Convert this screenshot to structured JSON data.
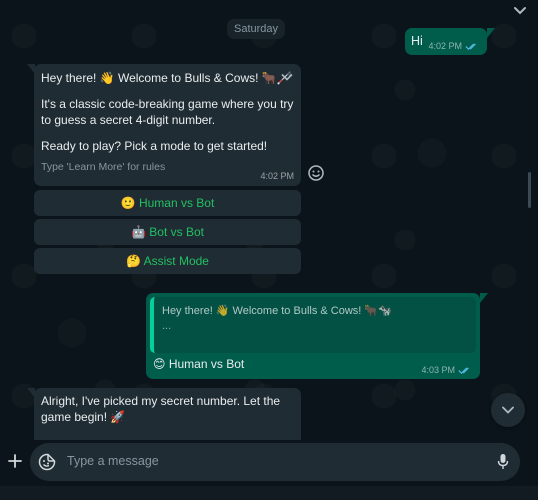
{
  "date_divider": "Saturday",
  "messages": {
    "hi": {
      "text": "Hi",
      "time": "4:02 PM",
      "status": "read"
    },
    "welcome": {
      "line1": "Hey there! 👋 Welcome to Bulls & Cows! 🐂🦯",
      "line2": "It's a classic code-breaking game where you try to guess a secret 4-digit number.",
      "line3": "Ready to play? Pick a mode to get started!",
      "footer": "Type 'Learn More' for rules",
      "time": "4:02 PM"
    },
    "buttons": [
      {
        "label": "🙂 Human vs Bot"
      },
      {
        "label": "🤖 Bot vs Bot"
      },
      {
        "label": "🤔 Assist Mode"
      }
    ],
    "reply": {
      "quote_line1": "Hey there! 👋 Welcome to Bulls & Cows! 🐂🐄",
      "quote_line2": "...",
      "text": "😊 Human vs Bot",
      "time": "4:03 PM",
      "status": "read"
    },
    "alright": {
      "text": "Alright, I've picked my secret number. Let the game begin! 🚀"
    }
  },
  "composer": {
    "placeholder": "Type a message"
  },
  "colors": {
    "background": "#0b141a",
    "incoming_bubble": "#202c33",
    "outgoing_bubble": "#005c4b",
    "accent_green": "#21c063",
    "read_ticks": "#53bdeb"
  },
  "icons": {
    "top": "chevron-down-icon",
    "menu": "chevron-down-icon",
    "react": "emoji-icon",
    "ticks": "double-check-icon",
    "scroll": "chevron-down-icon",
    "attach": "plus-icon",
    "sticker": "sticker-icon",
    "mic": "microphone-icon"
  }
}
